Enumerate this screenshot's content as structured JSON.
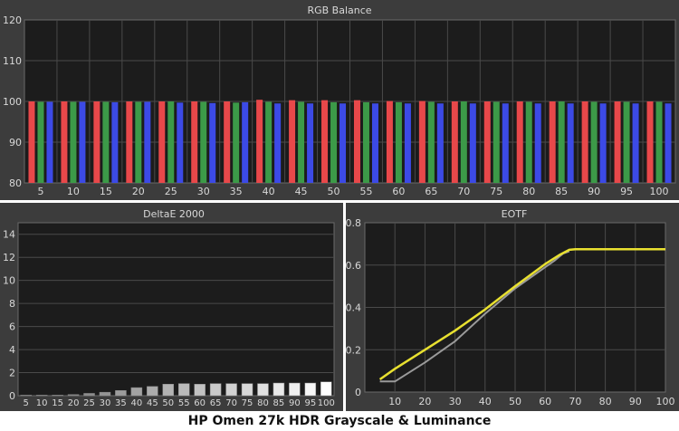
{
  "caption": "HP Omen 27k HDR Grayscale & Luminance",
  "colors": {
    "panel_bg": "#3c3c3c",
    "plot_bg": "#1c1c1c",
    "grid": "#4a4a4a",
    "text": "#d8d8d8",
    "red": "#e8484a",
    "green": "#3c9a48",
    "blue": "#3c4ae6",
    "eotf_measured": "#e8e030",
    "eotf_target": "#9a9a9a"
  },
  "chart_data": [
    {
      "id": "rgb",
      "type": "bar",
      "title": "RGB Balance",
      "categories": [
        "5",
        "10",
        "15",
        "20",
        "25",
        "30",
        "35",
        "40",
        "45",
        "50",
        "55",
        "60",
        "65",
        "70",
        "75",
        "80",
        "85",
        "90",
        "95",
        "100"
      ],
      "ylim": [
        80,
        120
      ],
      "yticks": [
        80,
        90,
        100,
        110,
        120
      ],
      "grid": true,
      "series": [
        {
          "key": "red",
          "values": [
            100,
            100,
            100,
            100,
            100,
            100,
            100,
            100.4,
            100.3,
            100.3,
            100.3,
            100.1,
            100.1,
            100,
            100,
            100,
            100,
            100,
            100,
            100
          ]
        },
        {
          "key": "green",
          "values": [
            99.9,
            99.9,
            99.9,
            99.9,
            100,
            99.9,
            99.7,
            99.9,
            99.9,
            99.8,
            99.8,
            99.8,
            99.9,
            100,
            99.9,
            99.9,
            100,
            99.9,
            99.9,
            99.9
          ]
        },
        {
          "key": "blue",
          "values": [
            99.9,
            99.9,
            99.8,
            99.9,
            99.7,
            99.6,
            99.8,
            99.5,
            99.5,
            99.5,
            99.5,
            99.5,
            99.5,
            99.5,
            99.5,
            99.5,
            99.5,
            99.5,
            99.5,
            99.5
          ]
        }
      ]
    },
    {
      "id": "deltae",
      "type": "bar",
      "title": "DeltaE 2000",
      "categories": [
        "5",
        "10",
        "15",
        "20",
        "25",
        "30",
        "35",
        "40",
        "45",
        "50",
        "55",
        "60",
        "65",
        "70",
        "75",
        "80",
        "85",
        "90",
        "95",
        "100"
      ],
      "values": [
        0.05,
        0.05,
        0.05,
        0.1,
        0.2,
        0.3,
        0.45,
        0.7,
        0.8,
        1.0,
        1.05,
        1.0,
        1.05,
        1.05,
        1.05,
        1.05,
        1.1,
        1.1,
        1.1,
        1.2
      ],
      "ylim": [
        0,
        15
      ],
      "yticks": [
        0,
        2,
        4,
        6,
        8,
        10,
        12,
        14
      ],
      "grid": true
    },
    {
      "id": "eotf",
      "type": "line",
      "title": "EOTF",
      "xlim": [
        0,
        100
      ],
      "ylim": [
        0,
        0.8
      ],
      "xticks": [
        10,
        20,
        30,
        40,
        50,
        60,
        70,
        80,
        90,
        100
      ],
      "yticks": [
        0,
        0.2,
        0.4,
        0.6,
        0.8
      ],
      "grid": true,
      "series": [
        {
          "key": "eotf_target",
          "x": [
            5,
            10,
            20,
            30,
            40,
            50,
            60,
            63,
            66,
            68
          ],
          "y": [
            0.05,
            0.05,
            0.14,
            0.24,
            0.37,
            0.49,
            0.59,
            0.62,
            0.655,
            0.665
          ]
        },
        {
          "key": "eotf_measured",
          "x": [
            5,
            10,
            20,
            30,
            40,
            50,
            60,
            65,
            68,
            70,
            80,
            90,
            100
          ],
          "y": [
            0.06,
            0.11,
            0.2,
            0.29,
            0.39,
            0.5,
            0.605,
            0.65,
            0.672,
            0.675,
            0.675,
            0.675,
            0.675
          ]
        }
      ]
    }
  ]
}
